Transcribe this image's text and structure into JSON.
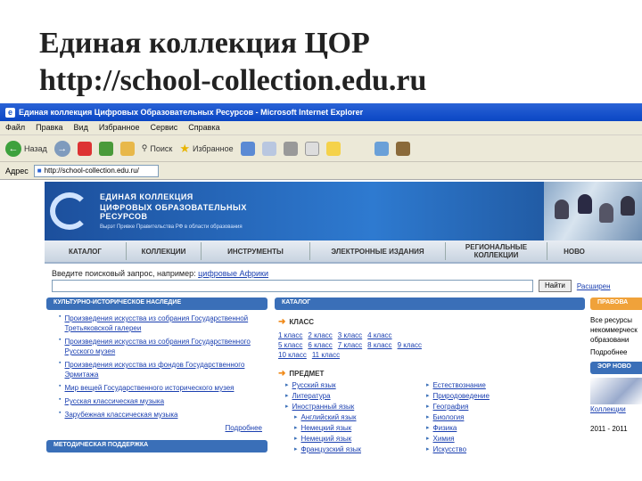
{
  "slide": {
    "title_line1": "Единая коллекция ЦОР",
    "title_line2": "http://school-collection.edu.ru"
  },
  "browser": {
    "window_title": "Единая коллекция Цифровых Образовательных Ресурсов - Microsoft Internet Explorer",
    "menu": [
      "Файл",
      "Правка",
      "Вид",
      "Избранное",
      "Сервис",
      "Справка"
    ],
    "toolbar": {
      "back": "Назад",
      "search": "Поиск",
      "favorites": "Избранное"
    },
    "address_label": "Адрес",
    "address_value": "http://school-collection.edu.ru/"
  },
  "site": {
    "banner": {
      "line1": "ЕДИНАЯ КОЛЛЕКЦИЯ",
      "line2": "ЦИФРОВЫХ ОБРАЗОВАТЕЛЬНЫХ РЕСУРСОВ",
      "line3": "Вырэт Привке Правительства РФ в области образования"
    },
    "nav": [
      "КАТАЛОГ",
      "КОЛЛЕКЦИИ",
      "ИНСТРУМЕНТЫ",
      "ЭЛЕКТРОННЫЕ ИЗДАНИЯ",
      "РЕГИОНАЛЬНЫЕ КОЛЛЕКЦИИ",
      "НОВО"
    ],
    "search": {
      "label": "Введите поисковый запрос, например:",
      "example": "цифровые Африки",
      "button": "Найти",
      "advanced": "Расширен"
    },
    "left_header": "КУЛЬТУРНО-ИСТОРИЧЕСКОЕ НАСЛЕДИЕ",
    "left_items": [
      "Произведения искусства из собрания Государственной Третьяковской галереи",
      "Произведения искусства из собрания Государственного Русского музея",
      "Произведения искусства из фондов Государственного Эрмитажа",
      "Мир вещей Государственного исторического музея",
      "Русская классическая музыка",
      "Зарубежная классическая музыка"
    ],
    "left_more": "Подробнее",
    "left_header2": "МЕТОДИЧЕСКАЯ ПОДДЕРЖКА",
    "catalog_header": "КАТАЛОГ",
    "class_title": "КЛАСС",
    "class_row1": [
      "1 класс",
      "2 класс",
      "3 класс",
      "4 класс"
    ],
    "class_row2": [
      "5 класс",
      "6 класс",
      "7 класс",
      "8 класс",
      "9 класс"
    ],
    "class_row3": [
      "10 класс",
      "11 класс"
    ],
    "subject_title": "ПРЕДМЕТ",
    "subjects_left": [
      "Русский язык",
      "Литература",
      "Иностранный язык",
      "Английский язык",
      "Немецкий язык",
      "Немецкий язык",
      "Французский язык"
    ],
    "subjects_right": [
      "Естествознание",
      "Природоведение",
      "География",
      "Биология",
      "Физика",
      "Химия",
      "Искусство"
    ],
    "right_header": "ПРАВОВА",
    "right_text": [
      "Все ресурсы",
      "некоммерческ",
      "образовани"
    ],
    "right_more": "Подробнее",
    "right_header2": "ЭОР НОВО",
    "right_link": "Коллекции",
    "right_year": "2011 - 2011"
  }
}
